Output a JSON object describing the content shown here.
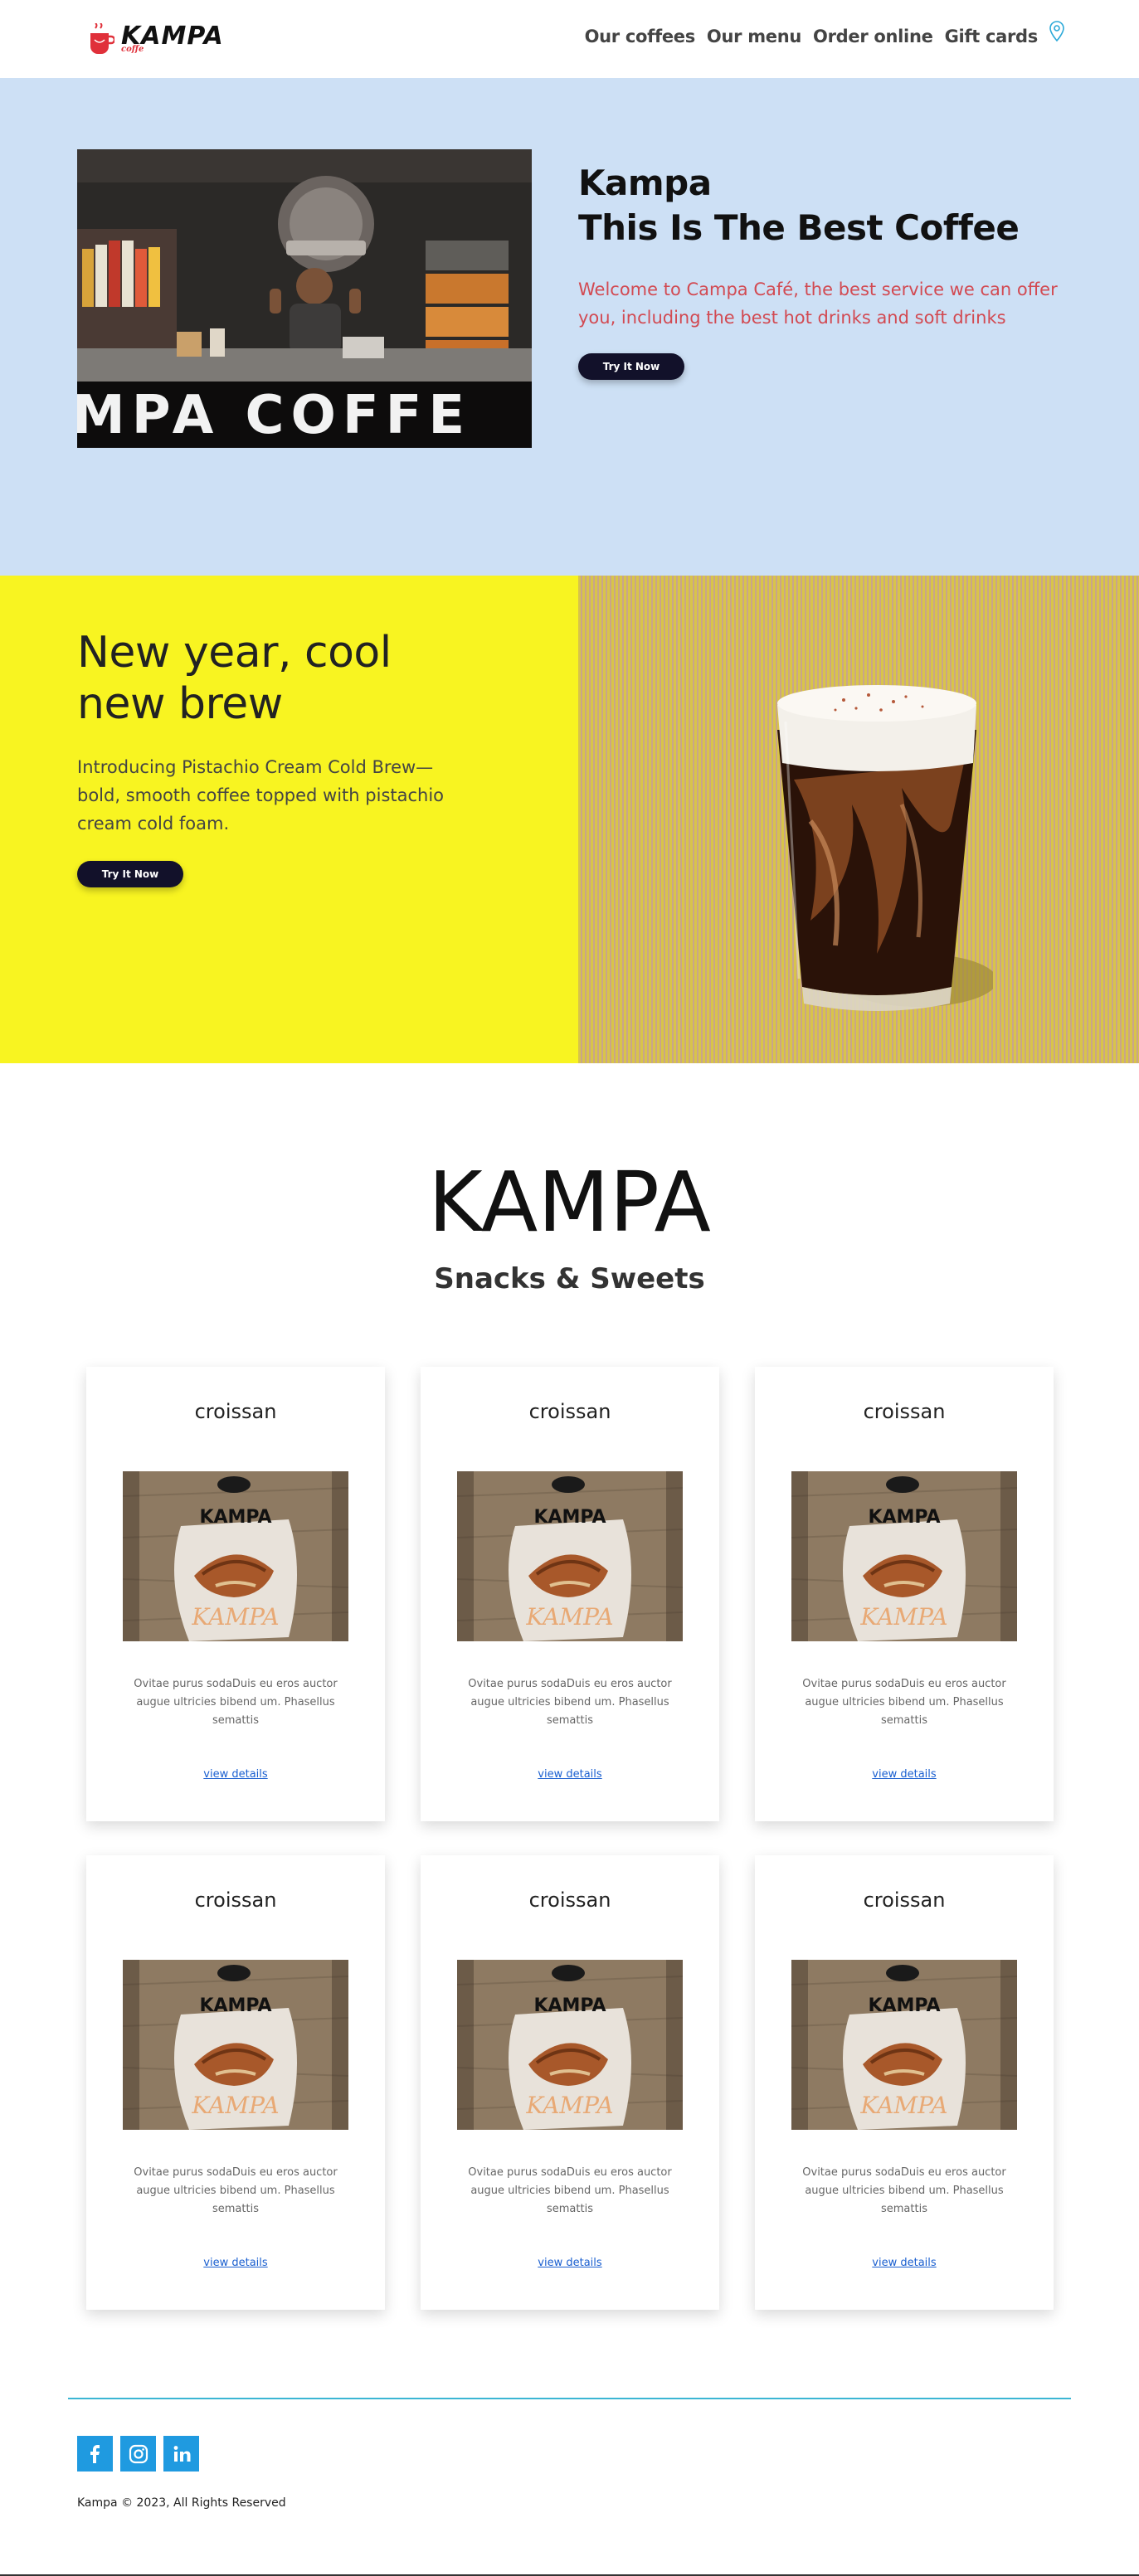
{
  "nav": {
    "logo_text": "KAMPA",
    "logo_sub": "coffe",
    "links": [
      "Our coffees",
      "Our menu",
      "Order online",
      "Gift cards"
    ],
    "location_icon": "map-pin-icon"
  },
  "hero": {
    "title_line1": "Kampa",
    "title_line2": "This Is The Best Coffee",
    "description": "Welcome to Campa Café, the best service we can offer you, including the best hot drinks and soft drinks",
    "button": "Try It Now",
    "sign_text": "MPA COFFE",
    "bg_color": "#cde0f5",
    "accent_color": "#d24a52"
  },
  "promo": {
    "title": "New year, cool new brew",
    "description": "Introducing Pistachio Cream Cold Brew—bold, smooth coffee topped with pistachio cream cold foam.",
    "button": "Try It Now",
    "bg_color": "#f8f421"
  },
  "menu": {
    "brand": "KAMPA",
    "subtitle": "Snacks & Sweets",
    "plate_text": "KAMPA",
    "items": [
      {
        "title": "croissan",
        "description": "Ovitae purus sodaDuis eu eros auctor augue ultricies bibend um. Phasellus semattis",
        "link": "view details"
      },
      {
        "title": "croissan",
        "description": "Ovitae purus sodaDuis eu eros auctor augue ultricies bibend um. Phasellus semattis",
        "link": "view details"
      },
      {
        "title": "croissan",
        "description": "Ovitae purus sodaDuis eu eros auctor augue ultricies bibend um. Phasellus semattis",
        "link": "view details"
      },
      {
        "title": "croissan",
        "description": "Ovitae purus sodaDuis eu eros auctor augue ultricies bibend um. Phasellus semattis",
        "link": "view details"
      },
      {
        "title": "croissan",
        "description": "Ovitae purus sodaDuis eu eros auctor augue ultricies bibend um. Phasellus semattis",
        "link": "view details"
      },
      {
        "title": "croissan",
        "description": "Ovitae purus sodaDuis eu eros auctor augue ultricies bibend um. Phasellus semattis",
        "link": "view details"
      }
    ]
  },
  "footer": {
    "social": [
      "facebook-icon",
      "instagram-icon",
      "linkedin-icon"
    ],
    "copyright": "Kampa © 2023, All Rights Reserved",
    "line_color": "#3cb6d4"
  }
}
